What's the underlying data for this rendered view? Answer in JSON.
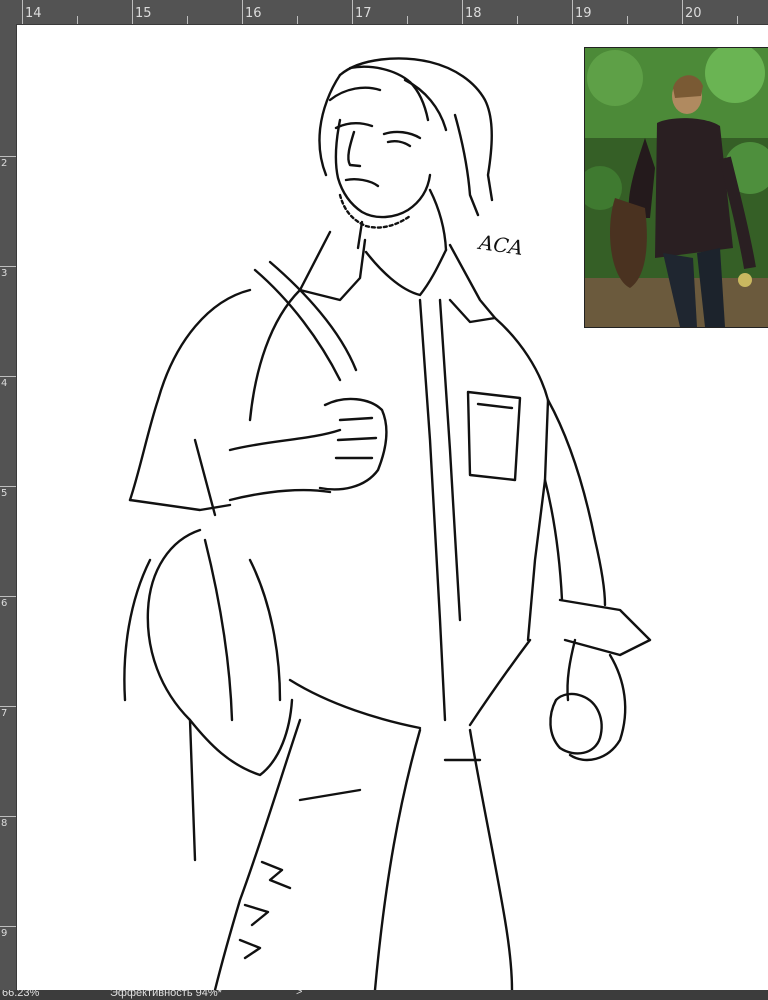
{
  "ruler": {
    "horizontal_labels": [
      "14",
      "15",
      "16",
      "17",
      "18",
      "19",
      "20"
    ],
    "vertical_labels": [
      "2",
      "3",
      "4",
      "5",
      "6",
      "7",
      "8",
      "9"
    ]
  },
  "artwork": {
    "signature": "ACA"
  },
  "status": {
    "zoom": "66.23%",
    "document": "Эффективность 94%*",
    "arrow": ">"
  },
  "colors": {
    "ruler_bg": "#535353",
    "canvas_bg": "#ffffff",
    "status_bg": "#3c3c3c",
    "ink": "#111111"
  }
}
